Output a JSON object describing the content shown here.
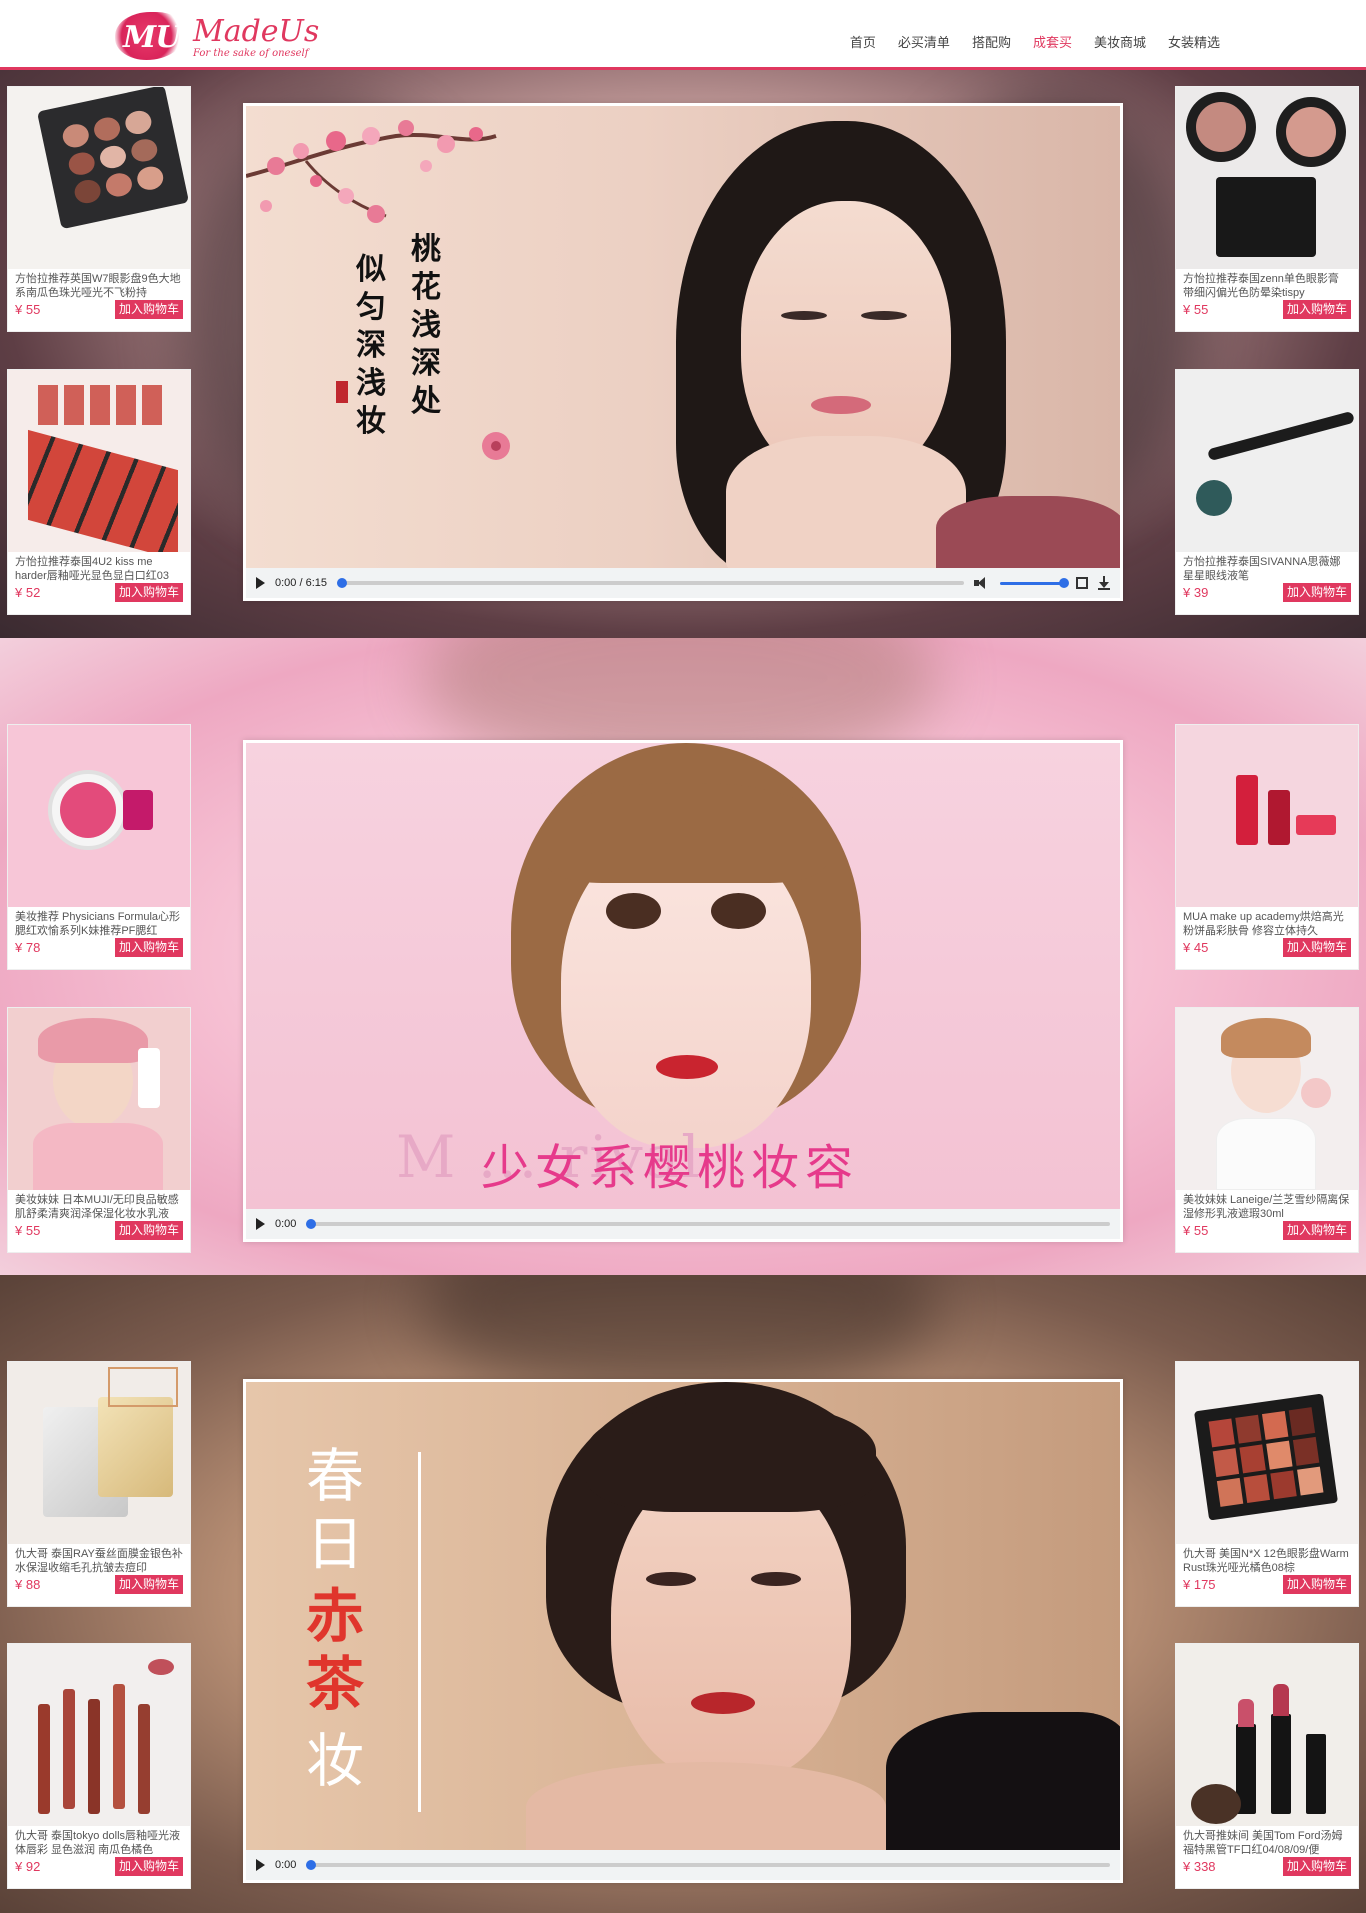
{
  "header": {
    "logo_mark": "MU",
    "logo_name": "MadeUs",
    "logo_tagline": "For the sake of oneself",
    "nav": [
      {
        "label": "首页"
      },
      {
        "label": "必买清单"
      },
      {
        "label": "搭配购"
      },
      {
        "label": "成套买",
        "active": true
      },
      {
        "label": "美妆商城"
      },
      {
        "label": "女装精选"
      }
    ]
  },
  "colors": {
    "accent": "#e0385f",
    "link": "#444444",
    "price": "#e0385f"
  },
  "sections": [
    {
      "video": {
        "overlay_text_lines": [
          "桃花浅深处",
          "似匀深浅妆"
        ],
        "time": "0:00 / 6:15"
      },
      "left_products": [
        {
          "title": "方怡拉推荐英国W7眼影盘9色大地系南瓜色珠光哑光不飞粉持",
          "price": "¥ 55",
          "cart": "加入购物车"
        },
        {
          "title": "方怡拉推荐泰国4U2 kiss me harder唇釉哑光显色显白口红03",
          "price": "¥ 52",
          "cart": "加入购物车"
        }
      ],
      "right_products": [
        {
          "title": "方怡拉推荐泰国zenn单色眼影膏 带细闪偏光色防晕染tispy",
          "price": "¥ 55",
          "cart": "加入购物车"
        },
        {
          "title": "方怡拉推荐泰国SIVANNA思薇娜星星眼线液笔",
          "price": "¥ 39",
          "cart": "加入购物车"
        }
      ]
    },
    {
      "video": {
        "overlay_text": "少女系樱桃妆容",
        "overlay_text_bg": "M ... rival",
        "time": "0:00"
      },
      "left_products": [
        {
          "title": "美妆推荐 Physicians Formula心形腮红欢愉系列K妹推荐PF腮红",
          "price": "¥ 78",
          "cart": "加入购物车"
        },
        {
          "title": "美妆妹妹 日本MUJI/无印良品敏感肌舒柔清爽润泽保湿化妆水乳液",
          "price": "¥ 55",
          "cart": "加入购物车"
        }
      ],
      "right_products": [
        {
          "title": "MUA make up academy烘焙高光粉饼晶彩肤骨 修容立体持久",
          "price": "¥ 45",
          "cart": "加入购物车"
        },
        {
          "title": "美妆妹妹 Laneige/兰芝雪纱隔离保湿修形乳液遮瑕30ml",
          "price": "¥ 55",
          "cart": "加入购物车"
        }
      ]
    },
    {
      "video": {
        "overlay_text_top": "春日",
        "overlay_text_mid": "赤茶",
        "overlay_text_bot": "妆",
        "time": "0:00"
      },
      "left_products": [
        {
          "title": "仇大哥 泰国RAY蚕丝面膜金银色补水保湿收缩毛孔抗皱去痘印",
          "price": "¥ 88",
          "cart": "加入购物车"
        },
        {
          "title": "仇大哥 泰国tokyo dolls唇釉哑光液体唇彩 显色滋润 南瓜色橘色",
          "price": "¥ 92",
          "cart": "加入购物车"
        }
      ],
      "right_products": [
        {
          "title": "仇大哥 美国N*X 12色眼影盘Warm Rust珠光哑光橘色08棕",
          "price": "¥ 175",
          "cart": "加入购物车"
        },
        {
          "title": "仇大哥推妹间 美国Tom Ford汤姆福特黑管TF口红04/08/09/便",
          "price": "¥ 338",
          "cart": "加入购物车"
        }
      ]
    }
  ]
}
